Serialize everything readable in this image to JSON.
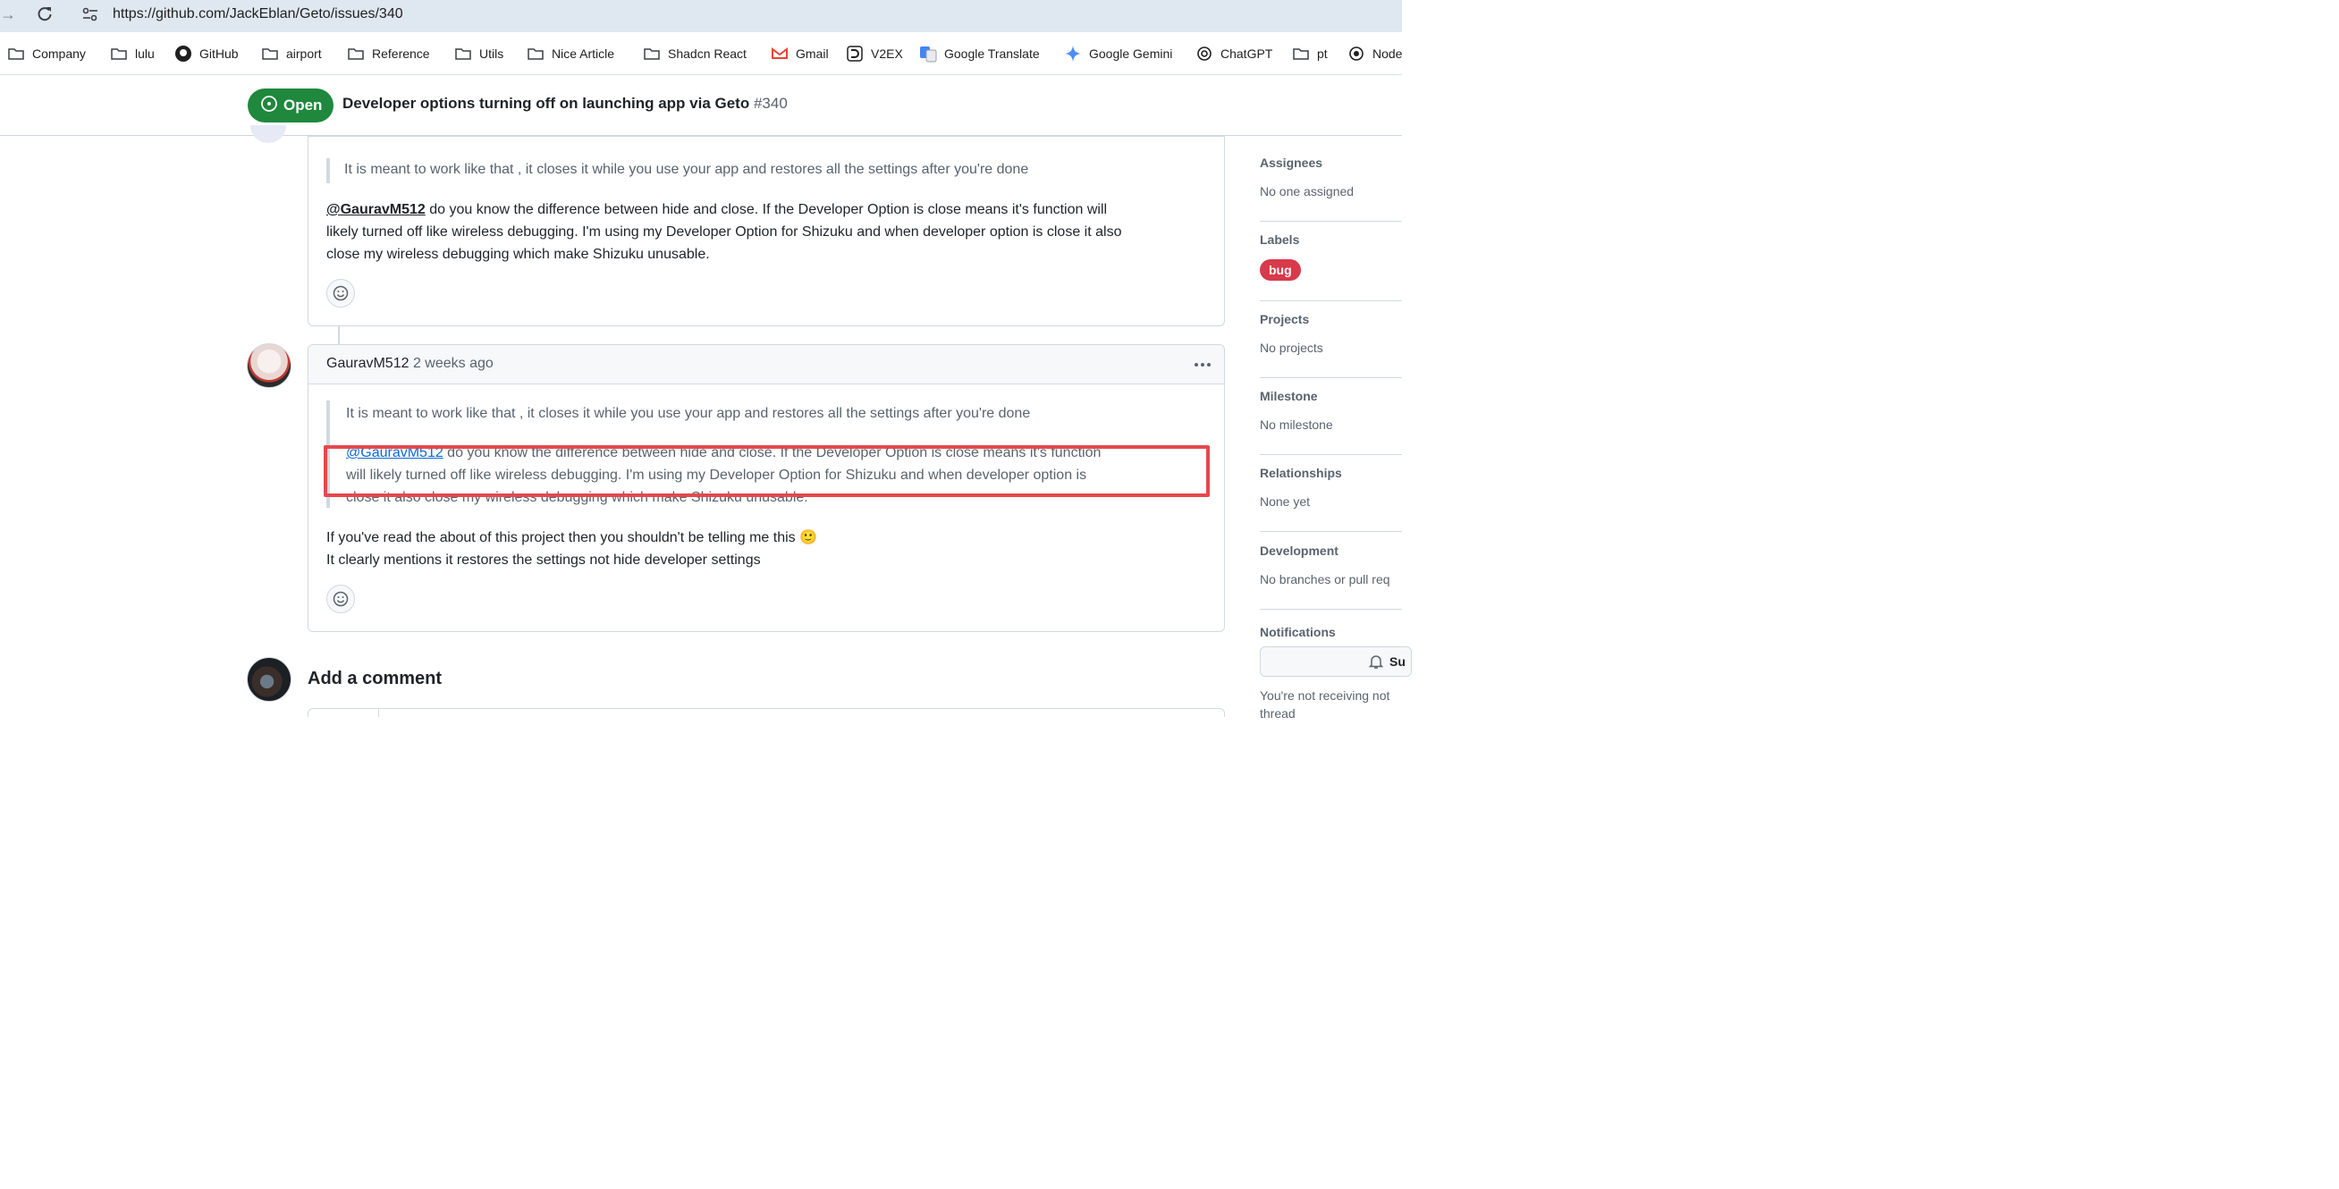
{
  "browser": {
    "url": "https://github.com/JackEblan/Geto/issues/340",
    "bookmarks": [
      "Company",
      "lulu",
      "GitHub",
      "airport",
      "Reference",
      "Utils",
      "Nice Article",
      "Shadcn React",
      "Gmail",
      "V2EX",
      "Google Translate",
      "Google Gemini",
      "ChatGPT",
      "pt",
      "Node"
    ]
  },
  "issue": {
    "status": "Open",
    "title": "Developer options turning off on launching app via Geto",
    "number": "#340"
  },
  "comments": [
    {
      "quote": "It is meant to work like that , it closes it while you use your app and restores all the settings after you're done",
      "mention": "@GauravM512",
      "body_line1": " do you know the difference between hide and close. If the Developer Option is close means it's function will",
      "body_line2": "likely turned off like wireless debugging. I'm using my Developer Option for Shizuku and when developer option is close it also",
      "body_line3": "close my wireless debugging which make Shizuku unusable."
    },
    {
      "author": "GauravM512",
      "time": "2 weeks ago",
      "quote": "It is meant to work like that , it closes it while you use your app and restores all the settings after you're done",
      "nested_mention": "@GauravM512",
      "nested_line1": " do you know the difference between hide and close. If the Developer Option is close means it's function",
      "nested_line2": "will likely turned off like wireless debugging. I'm using my Developer Option for Shizuku and when developer option is",
      "nested_line3": "close it also close my wireless debugging which make Shizuku unusable.",
      "reply_line1": "If you've read the about of this project then you shouldn't be telling me this 🙂",
      "reply_line2": "It clearly mentions it restores the settings not hide developer settings"
    }
  ],
  "add_comment": "Add a comment",
  "sidebar": {
    "assignees_title": "Assignees",
    "assignees_value": "No one assigned",
    "labels_title": "Labels",
    "label_bug": "bug",
    "projects_title": "Projects",
    "projects_value": "No projects",
    "milestone_title": "Milestone",
    "milestone_value": "No milestone",
    "relationships_title": "Relationships",
    "relationships_value": "None yet",
    "development_title": "Development",
    "development_value": "No branches or pull req",
    "notifications_title": "Notifications",
    "subscribe_label": "Su",
    "notifications_text": "You're not receiving not thread"
  },
  "colors": {
    "open_green": "#1f883d",
    "bug_red": "#d73a4a",
    "link_blue": "#0969da",
    "highlight_red": "#e5484d"
  }
}
